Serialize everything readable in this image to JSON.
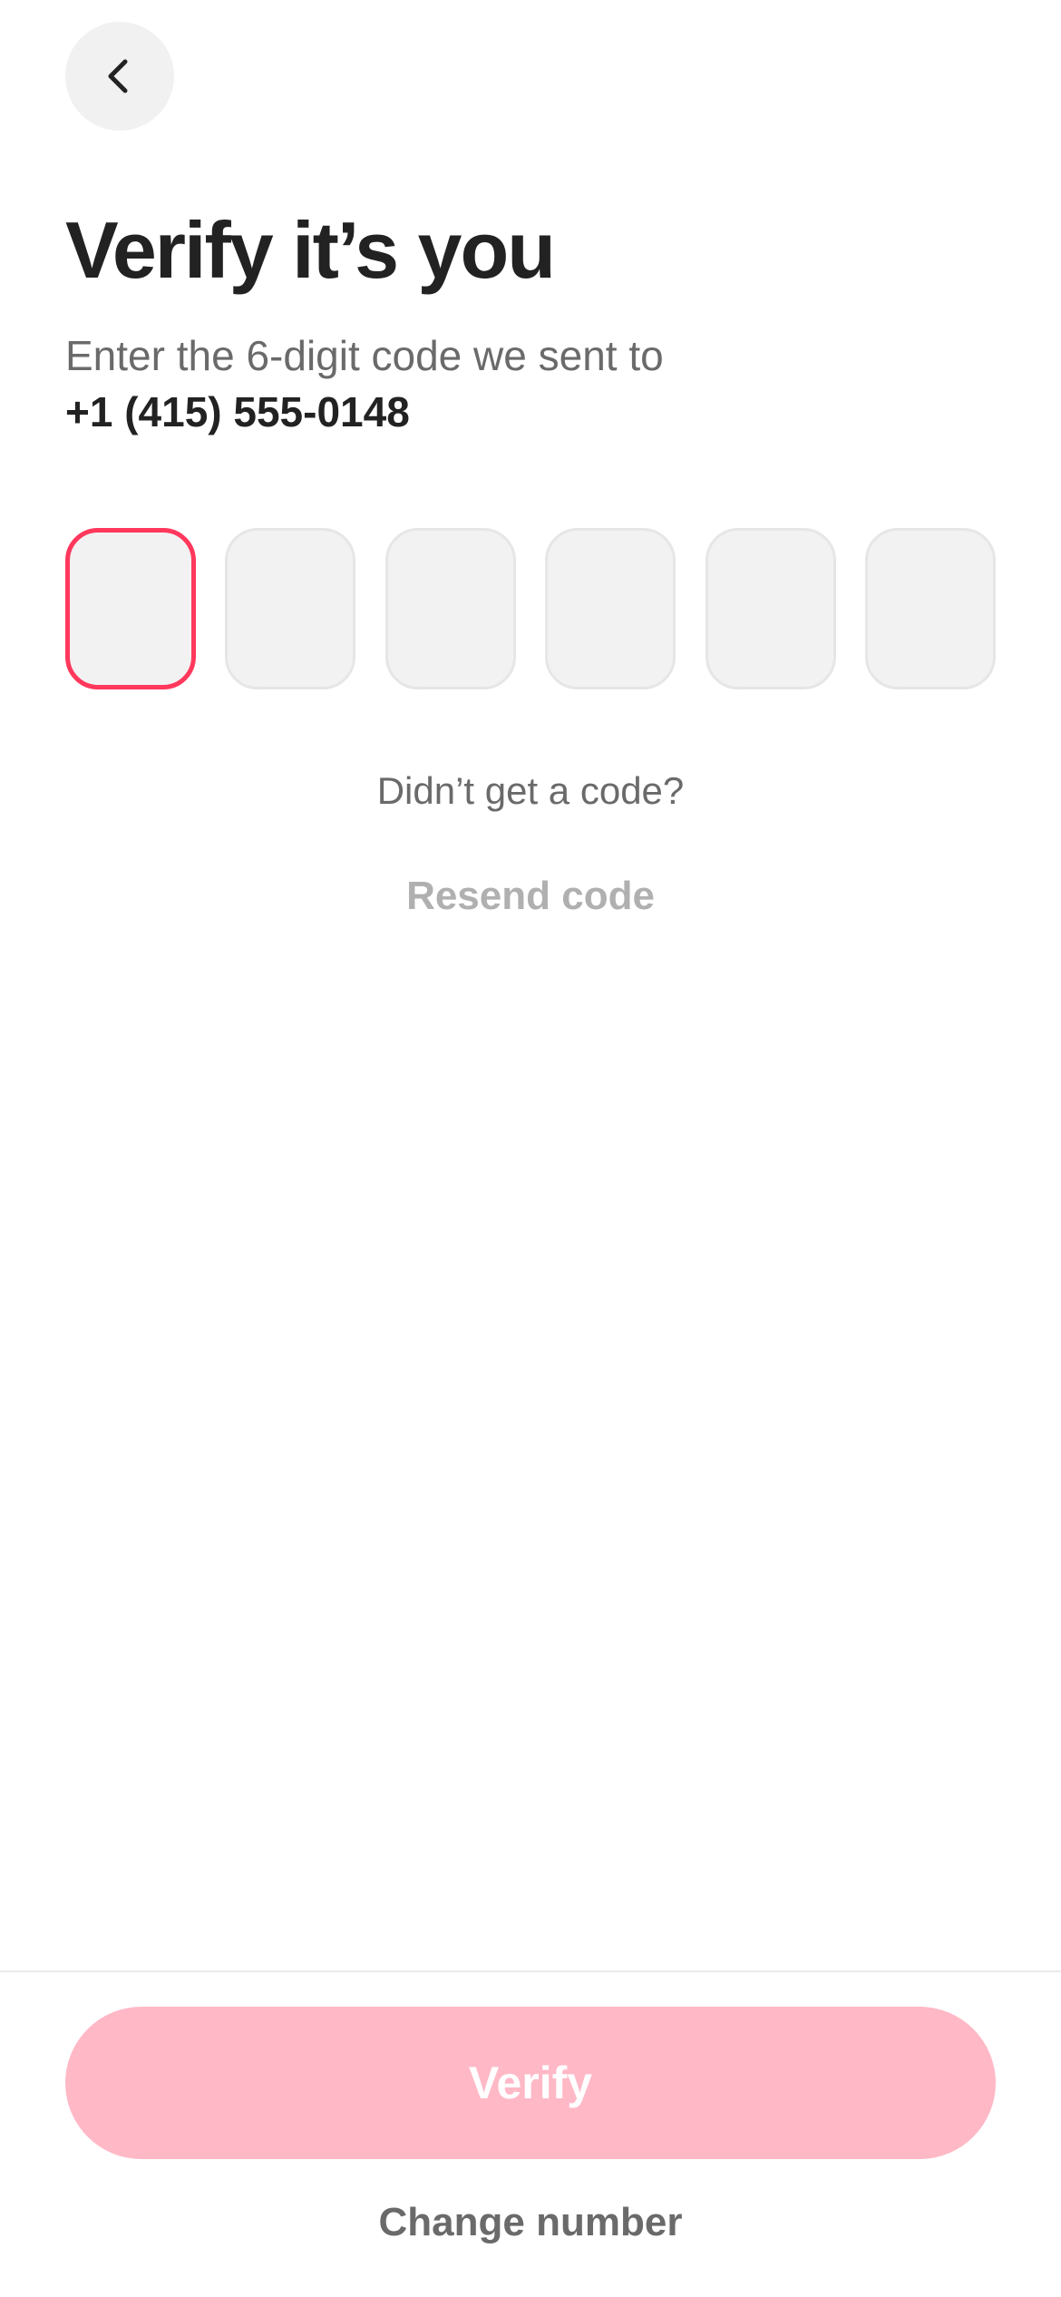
{
  "header": {
    "back_icon": "chevron-left-icon"
  },
  "title": "Verify it’s you",
  "subtitle": "Enter the 6-digit code we sent to",
  "phone_number": "+1 (415) 555-0148",
  "otp": {
    "digits": [
      "",
      "",
      "",
      "",
      "",
      ""
    ],
    "active_index": 0
  },
  "resend": {
    "prompt": "Didn’t get a code?",
    "label": "Resend code"
  },
  "actions": {
    "verify_label": "Verify",
    "change_number_label": "Change number"
  },
  "colors": {
    "accent": "#ff385c",
    "verify_disabled": "#ffb8c6",
    "text_primary": "#222222",
    "text_secondary": "#6a6a6a",
    "text_disabled": "#b0b0b0",
    "input_bg": "#f2f2f2"
  }
}
